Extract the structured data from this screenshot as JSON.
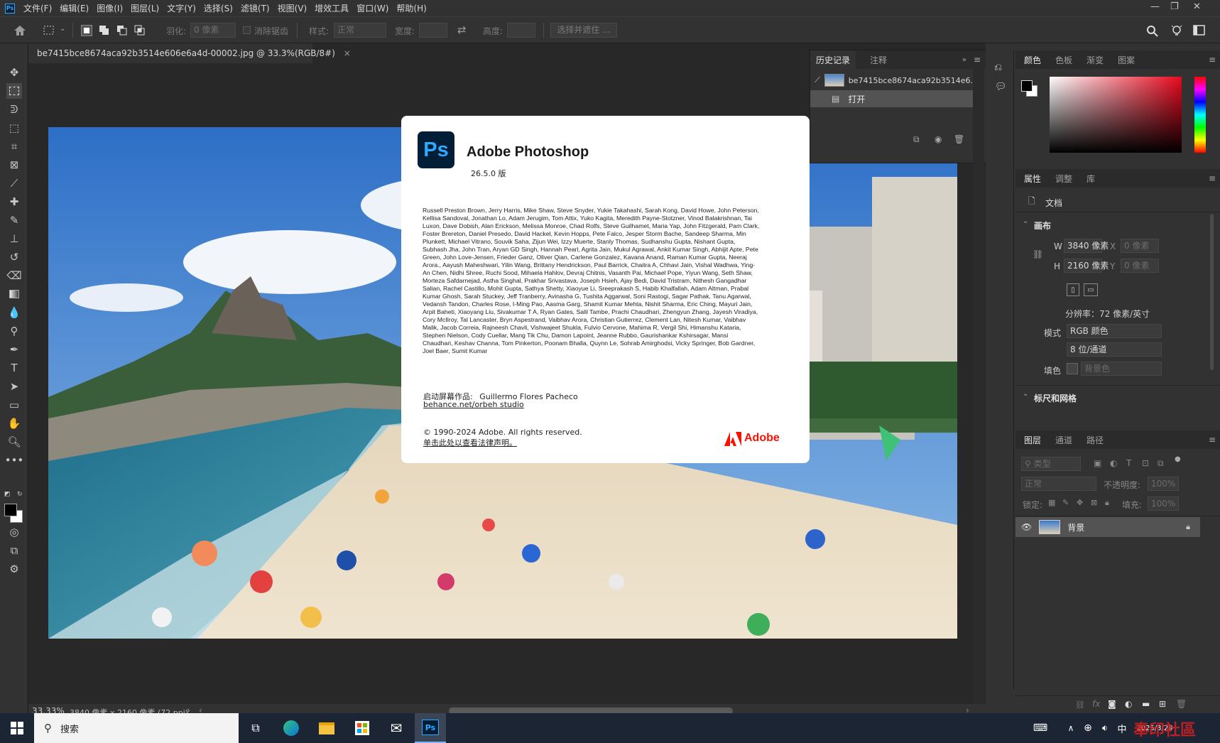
{
  "menubar": {
    "logo": "Ps",
    "items": [
      "文件(F)",
      "编辑(E)",
      "图像(I)",
      "图层(L)",
      "文字(Y)",
      "选择(S)",
      "滤镜(T)",
      "视图(V)",
      "增效工具",
      "窗口(W)",
      "帮助(H)"
    ]
  },
  "options": {
    "feather_label": "羽化:",
    "feather_value": "0 像素",
    "antialias_label": "消除锯齿",
    "style_label": "样式:",
    "style_value": "正常",
    "width_label": "宽度:",
    "height_label": "高度:",
    "select_mask": "选择并遮住 ..."
  },
  "document": {
    "tab_title": "be7415bce8674aca92b3514e606e6a4d-00002.jpg @ 33.3%(RGB/8#)",
    "close": "×"
  },
  "status": {
    "zoom": "33.33%",
    "info": "3840 像素 x 2160 像素 (72 ppi)"
  },
  "about": {
    "logo_text": "Ps",
    "app_name": "Adobe Photoshop",
    "version": "26.5.0 版",
    "credits": "Russell Preston Brown, Jerry Harris, Mike Shaw, Steve Snyder, Yukie Takahashi, Sarah Kong, David Howe, John Peterson, Kellisa Sandoval, Jonathan Lo, Adam Jerugim, Tom Attix, Yuko Kagita, Meredith Payne-Stotzner, Vinod Balakrishnan, Tai Luxon, Dave Dobish, Alan Erickson, Melissa Monroe, Chad Rolfs, Steve Guilhamet, Maria Yap, John Fitzgerald, Pam Clark, Foster Brereton, Daniel Presedo, David Hackel, Kevin Hopps, Pete Falco, Jesper Storm Bache, Sandeep Sharma, Min Plunkett, Michael Vitrano, Souvik Saha, Zijun Wei, Izzy Muerte, Stanly Thomas, Sudhanshu Gupta, Nishant Gupta, Subhash Jha, John Tran, Aryan GD Singh, Hannah Pearl, Agrita Jain, Mukul Agrawal, Ankit Kumar Singh, Abhijit Apte, Pete Green, John Love-Jensen, Frieder Ganz, Oliver Qian, Carlene Gonzalez, Kavana Anand, Raman Kumar Gupta, Neeraj Arora., Aayush Maheshwari, Yilin Wang, Brittany Hendrickson, Paul Barrick, Chaitra A, Chhavi Jain, Vishal Wadhwa, Ying-An Chen, Nidhi Shree, Ruchi Sood, Mihaela Hahlov, Devraj Chitnis, Vasanth Pai, Michael Pope, Yiyun Wang, Seth Shaw, Morteza Safdarnejad, Astha Singhal, Prakhar Srivastava, Joseph Hsieh, Ajay Bedi, David Tristram, Nithesh Gangadhar Salian, Rachel Castillo, Mohit Gupta, Sathya Shetty, Xiaoyue Li, Sreeprakash S, Habib Khalfallah, Adam Altman, Prabal Kumar Ghosh, Sarah Stuckey, Jeff Tranberry, Avinasha G, Tushita Aggarwal, Soni Rastogi, Sagar Pathak, Tanu Agarwal, Vedansh Tandon, Charles Rose, I-Ming Pao, Aasma Garg, Shamit Kumar Mehta, Nishit Sharma, Eric Ching, Mayuri Jain, Arpit Baheti, Xiaoyang Liu, Sivakumar T A, Ryan Gates, Salil Tambe, Prachi Chaudhari, Zhengyun Zhang, Jayesh Viradiya, Cory McIlroy, Tal Lancaster, Bryn Aspestrand, Vaibhav Arora, Christian Gutierrez, Clement Lan, Nitesh Kumar, Vaibhav Malik, Jacob Correia, Rajneesh Chavli, Vishwajeet Shukla, Fulvio Cervone, Mahima R, Vergil Shi, Himanshu Kataria, Stephen Nielson, Cody Cuellar, Mang Tik Chu, Damon Lapoint, Jeanne Rubbo, Gaurishankar Kshirsagar, Mansi Chaudhari, Keshav Channa, Tom Pinkerton, Poonam Bhalla, Quynn Le, Sohrab Amirghodsi, Vicky Springer, Bob Gardner, Joel Baer, Sumit Kumar",
    "splash_label": "启动屏幕作品:",
    "splash_artist": "Guillermo Flores Pacheco",
    "splash_link": "behance.net/orbeh studio",
    "copyright": "© 1990-2024 Adobe. All rights reserved.",
    "legal_link": "单击此处以查看法律声明。",
    "adobe_brand": "Adobe",
    "accent": "#fa0f00"
  },
  "history": {
    "tabs": [
      "历史记录",
      "注释"
    ],
    "snapshot_name": "be7415bce8674aca92b3514e6...",
    "items": [
      "打开"
    ]
  },
  "color_panel": {
    "tabs": [
      "颜色",
      "色板",
      "渐变",
      "图案"
    ]
  },
  "properties": {
    "tabs": [
      "属性",
      "调整",
      "库"
    ],
    "doc_label": "文档",
    "canvas_header": "画布",
    "w_label": "W",
    "w_value": "3840 像素",
    "h_label": "H",
    "h_value": "2160 像素",
    "x_label": "X",
    "x_value": "0 像素",
    "y_label": "Y",
    "y_value": "0 像素",
    "resolution": "分辨率：72 像素/英寸",
    "mode_label": "模式",
    "mode_value": "RGB 颜色",
    "depth_value": "8 位/通道",
    "fill_label": "填色",
    "fill_value": "背景色",
    "rulers_header": "标尺和网格"
  },
  "layers": {
    "tabs": [
      "图层",
      "通道",
      "路径"
    ],
    "filter_placeholder": "类型",
    "blend_mode": "正常",
    "opacity_label": "不透明度:",
    "opacity_value": "100%",
    "lock_label": "锁定:",
    "fill_label": "填充:",
    "fill_value": "100%",
    "items": [
      {
        "name": "背景"
      }
    ]
  },
  "taskbar": {
    "search_placeholder": "搜索",
    "ime": "中",
    "date": "2025/3/29",
    "watermark": "奉印社區"
  }
}
